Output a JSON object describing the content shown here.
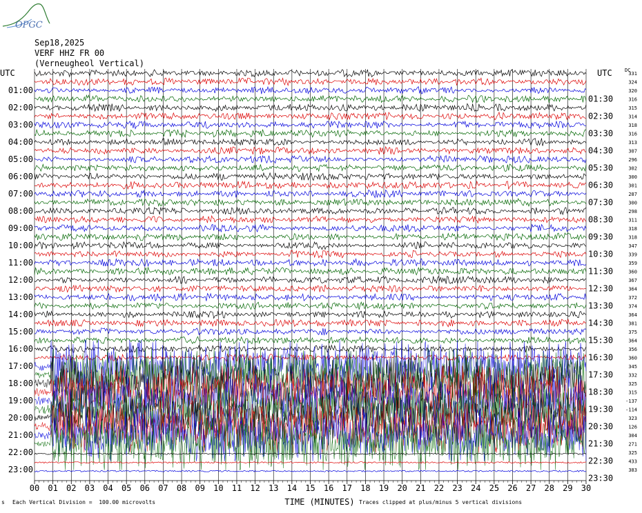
{
  "header": {
    "logo_text": "OPGC",
    "date": "Sep18,2025",
    "station": "VERF HHZ FR 00",
    "description": "(Verneugheol Vertical)",
    "utc_left": "UTC",
    "utc_right": "UTC",
    "corner": "DC"
  },
  "footer": {
    "left_mark": "s",
    "division_note": "Each Vertical Division =  100.00 microvolts",
    "xlabel": "TIME (MINUTES)",
    "clip_note": "Traces clipped at plus/minus 5 vertical divisions"
  },
  "colors": {
    "trace_colors": [
      "#000000",
      "#dd0000",
      "#0000dd",
      "#006600"
    ],
    "grid": "#000000",
    "logo": "#2e7d32"
  },
  "chart_data": {
    "type": "line",
    "title": "",
    "xlabel": "TIME (MINUTES)",
    "x_ticks": [
      "00",
      "01",
      "02",
      "03",
      "04",
      "05",
      "06",
      "07",
      "08",
      "09",
      "10",
      "11",
      "12",
      "13",
      "14",
      "15",
      "16",
      "17",
      "18",
      "19",
      "20",
      "21",
      "22",
      "23",
      "24",
      "25",
      "26",
      "27",
      "28",
      "29",
      "30"
    ],
    "xlim": [
      0,
      30
    ],
    "left_hour_labels": [
      "UTC",
      "01:00",
      "02:00",
      "03:00",
      "04:00",
      "05:00",
      "06:00",
      "07:00",
      "08:00",
      "09:00",
      "10:00",
      "11:00",
      "12:00",
      "13:00",
      "14:00",
      "15:00",
      "16:00",
      "17:00",
      "18:00",
      "19:00",
      "20:00",
      "21:00",
      "22:00",
      "23:00"
    ],
    "right_hour_labels": [
      "UTC",
      "01:30",
      "02:30",
      "03:30",
      "04:30",
      "05:30",
      "06:30",
      "07:30",
      "08:30",
      "09:30",
      "10:30",
      "11:30",
      "12:30",
      "13:30",
      "14:30",
      "15:30",
      "16:30",
      "17:30",
      "18:30",
      "19:30",
      "20:30",
      "21:30",
      "22:30",
      "23:30"
    ],
    "trace_offsets": [
      "331",
      "324",
      "320",
      "316",
      "315",
      "314",
      "318",
      "316",
      "313",
      "307",
      "296",
      "302",
      "300",
      "301",
      "287",
      "300",
      "298",
      "311",
      "318",
      "318",
      "347",
      "339",
      "359",
      "360",
      "367",
      "364",
      "372",
      "374",
      "364",
      "381",
      "375",
      "364",
      "356",
      "360",
      "345",
      "332",
      "325",
      "315",
      "-137",
      "-114",
      "323",
      "126",
      "304",
      "271",
      "325",
      "433",
      "383"
    ],
    "trace_count": 47,
    "minutes_per_trace": 30,
    "clipped_traces_start_row": 34,
    "clipped_traces_end_row": 43,
    "units": "microvolts",
    "division_microvolts": 100.0,
    "clip_divisions": 5
  }
}
